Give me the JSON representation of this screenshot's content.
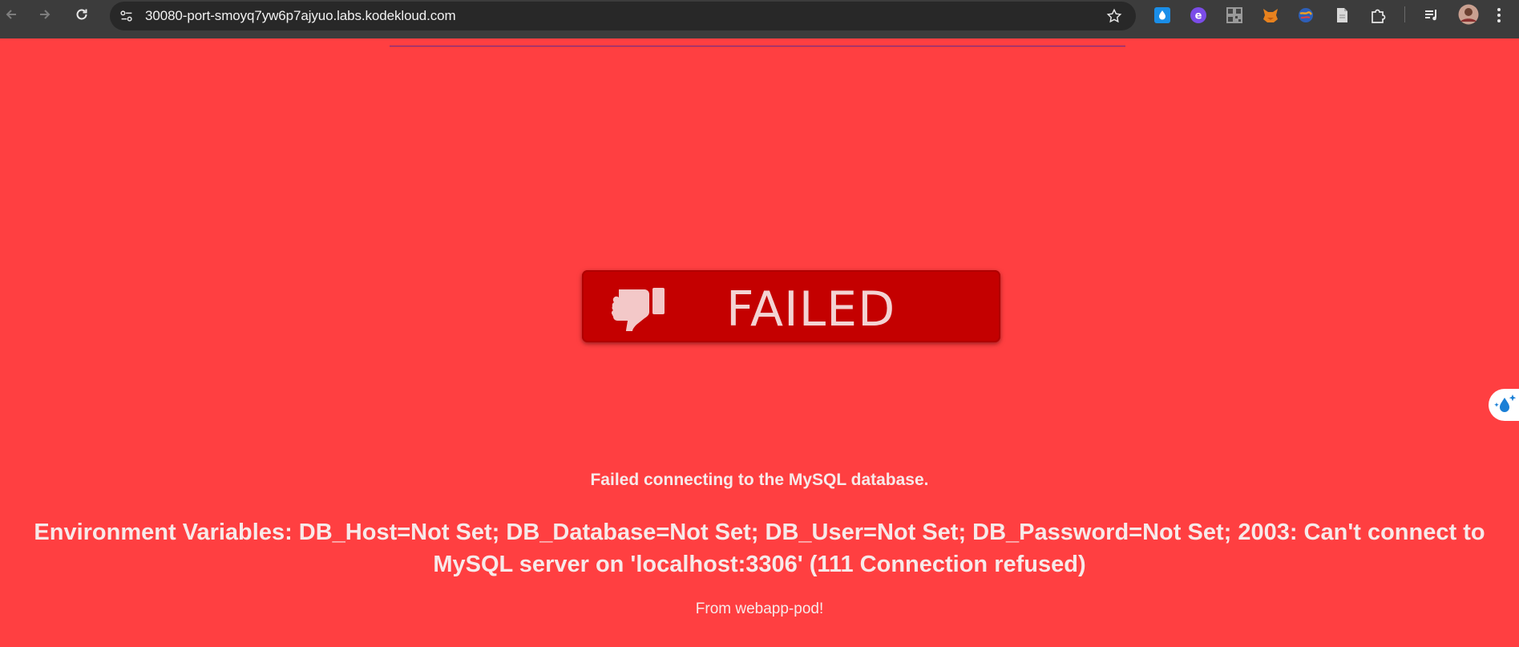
{
  "browser": {
    "url": "30080-port-smoyq7yw6p7ajyuo.labs.kodekloud.com",
    "icons": {
      "back": "back-arrow-icon",
      "forward": "forward-arrow-icon",
      "reload": "reload-icon",
      "site_info": "site-settings-icon",
      "bookmark": "star-icon",
      "extensions": [
        "droplet-extension-icon",
        "e-extension-icon",
        "qr-extension-icon",
        "fox-extension-icon",
        "globe-extension-icon",
        "document-extension-icon",
        "puzzle-extensions-icon",
        "media-queue-icon",
        "profile-avatar-icon",
        "more-menu-icon"
      ]
    }
  },
  "page": {
    "banner_label": "FAILED",
    "banner_icon": "thumbs-down-icon",
    "message": "Failed connecting to the MySQL database.",
    "environment_line1": "Environment Variables: DB_Host=Not Set; DB_Database=Not Set; DB_User=Not Set; DB_Password=Not Set; 2003: Can't connect to",
    "environment_line2": "MySQL server on 'localhost:3306' (111 Connection refused)",
    "footer": "From webapp-pod!",
    "colors": {
      "background": "#ff3f41",
      "banner": "#c40000",
      "text": "#f7e9e9"
    }
  }
}
